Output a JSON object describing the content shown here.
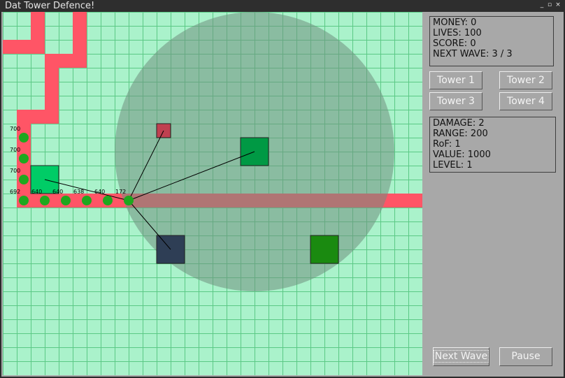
{
  "window": {
    "title": "Dat Tower Defence!",
    "minimize_glyph": "_",
    "maximize_glyph": "▫",
    "close_glyph": "×"
  },
  "colors": {
    "grass": "#aaf2cb",
    "grid": "#5bc985",
    "path": "#ff5566",
    "range": "#6f8f7f",
    "enemy": "#1ea81e"
  },
  "stats": {
    "money": "MONEY: 0",
    "lives": "LIVES: 100",
    "score": "SCORE: 0",
    "next_wave": "NEXT WAVE: 3 / 3"
  },
  "tower_buttons": {
    "tower1": "Tower 1",
    "tower2": "Tower 2",
    "tower3": "Tower 3",
    "tower4": "Tower 4"
  },
  "tower_info": {
    "damage": "DAMAGE: 2",
    "range": "RANGE: 200",
    "rof": "RoF: 1",
    "value": "VALUE: 1000",
    "level": "LEVEL: 1"
  },
  "controls": {
    "next_wave": "Next Wave",
    "pause": "Pause"
  },
  "enemies": [
    {
      "hp": "700"
    },
    {
      "hp": "700"
    },
    {
      "hp": "700"
    },
    {
      "hp": "692"
    },
    {
      "hp": "640"
    },
    {
      "hp": "640"
    },
    {
      "hp": "638"
    },
    {
      "hp": "640"
    },
    {
      "hp": "172"
    }
  ],
  "towers": [
    {
      "type": "tower-1",
      "color": "#00cc66"
    },
    {
      "type": "tower-2",
      "color": "#c04050"
    },
    {
      "type": "tower-3",
      "color": "#009944"
    },
    {
      "type": "tower-4",
      "color": "#2e3e55"
    },
    {
      "type": "tower-5",
      "color": "#1a8a10"
    }
  ]
}
